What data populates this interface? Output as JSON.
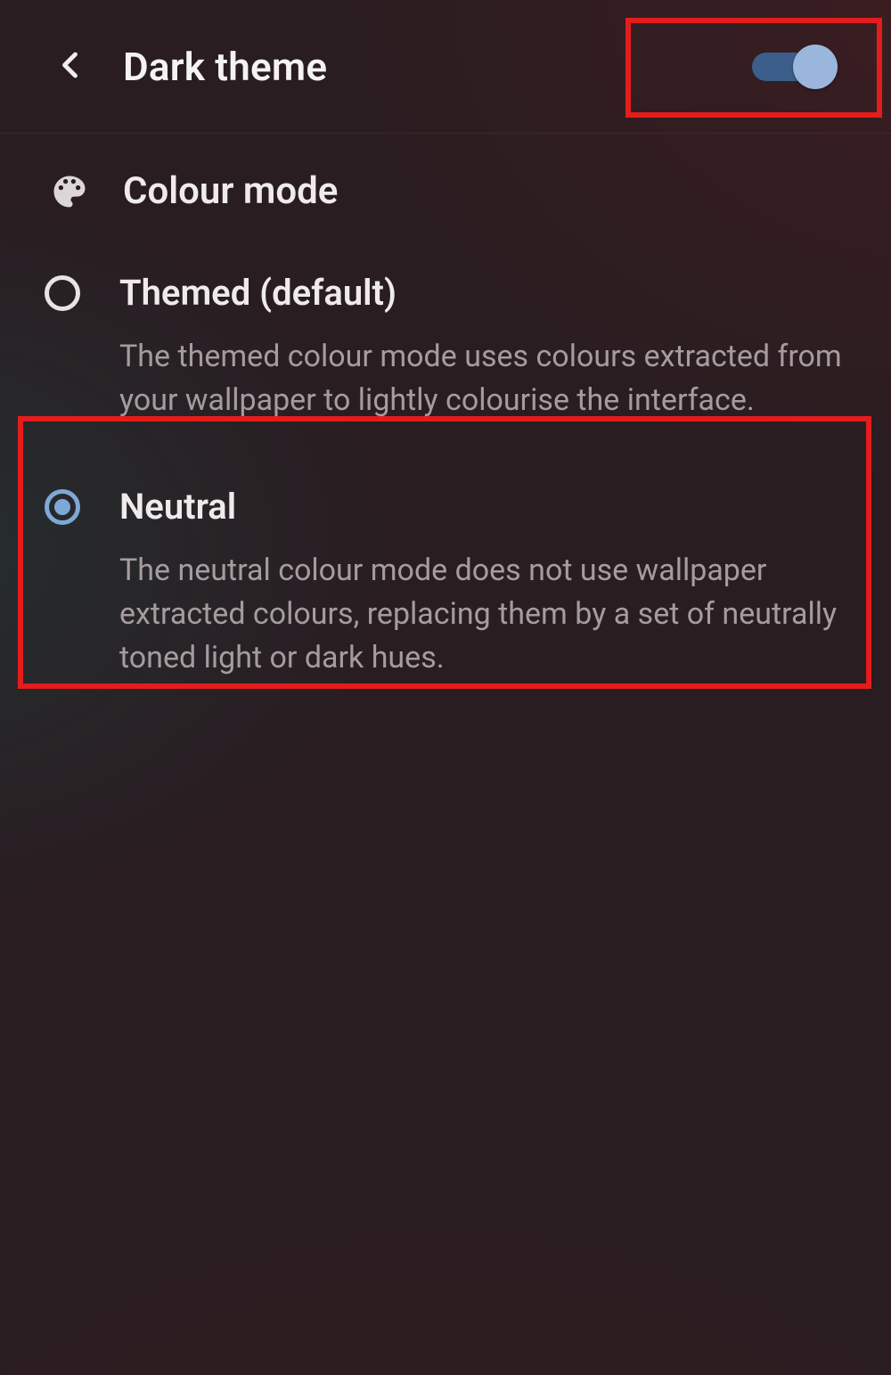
{
  "header": {
    "title": "Dark theme",
    "toggle_on": true
  },
  "section": {
    "title": "Colour mode"
  },
  "options": {
    "themed": {
      "label": "Themed (default)",
      "description": "The themed colour mode uses colours extracted from your wallpaper to lightly colourise the interface.",
      "selected": false
    },
    "neutral": {
      "label": "Neutral",
      "description": "The neutral colour mode does not use wallpaper extracted colours, replacing them by a set of neutrally toned light or dark hues.",
      "selected": true
    }
  },
  "colors": {
    "accent": "#7fa8d8",
    "highlight": "#e51c1c"
  }
}
